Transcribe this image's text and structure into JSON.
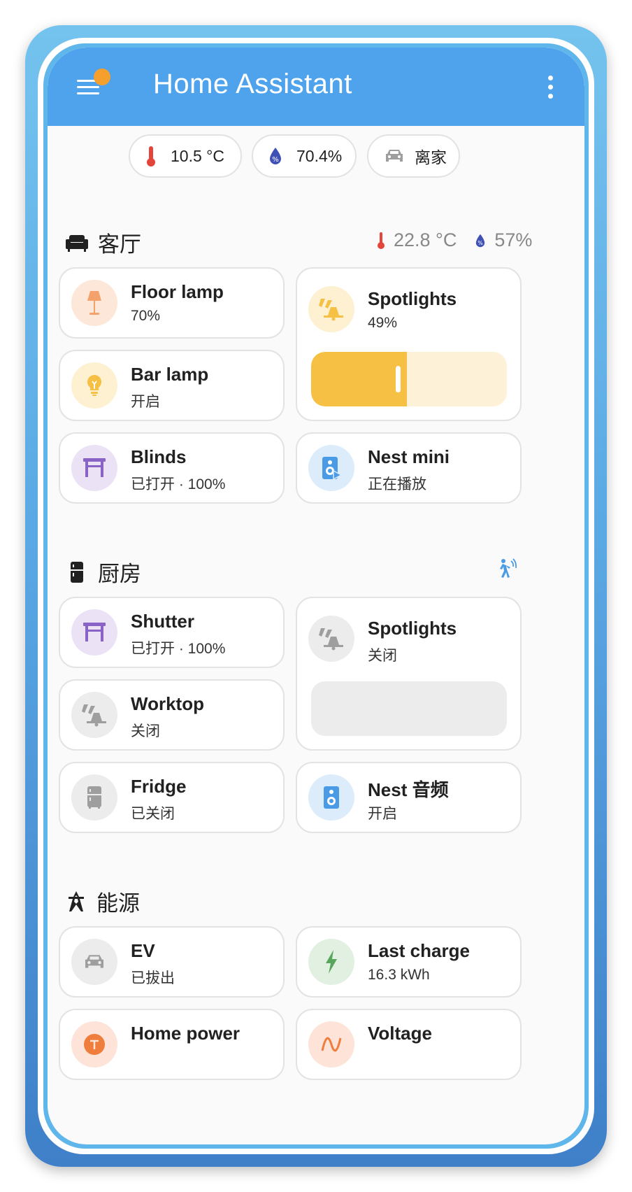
{
  "app": {
    "title": "Home Assistant"
  },
  "badges": [
    {
      "icon": "thermometer-icon",
      "text": "10.5 °C"
    },
    {
      "icon": "humidity-icon",
      "text": "70.4%"
    },
    {
      "icon": "car-icon",
      "text": "离家"
    }
  ],
  "sections": {
    "living": {
      "title": "客厅",
      "temperature": "22.8 °C",
      "humidity": "57%",
      "cards": {
        "floor_lamp": {
          "name": "Floor lamp",
          "state": "70%"
        },
        "spotlights": {
          "name": "Spotlights",
          "state": "49%",
          "brightness": 49
        },
        "bar_lamp": {
          "name": "Bar lamp",
          "state": "开启"
        },
        "blinds": {
          "name": "Blinds",
          "state": "已打开 · 100%"
        },
        "nest_mini": {
          "name": "Nest mini",
          "state": "正在播放"
        }
      }
    },
    "kitchen": {
      "title": "厨房",
      "cards": {
        "shutter": {
          "name": "Shutter",
          "state": "已打开 · 100%"
        },
        "spotlights": {
          "name": "Spotlights",
          "state": "关闭",
          "brightness": 0
        },
        "worktop": {
          "name": "Worktop",
          "state": "关闭"
        },
        "fridge": {
          "name": "Fridge",
          "state": "已关闭"
        },
        "nest_audio": {
          "name": "Nest 音频",
          "state": "开启"
        }
      }
    },
    "energy": {
      "title": "能源",
      "cards": {
        "ev": {
          "name": "EV",
          "state": "已拔出"
        },
        "last_charge": {
          "name": "Last charge",
          "state": "16.3 kWh"
        },
        "home_power": {
          "name": "Home power"
        },
        "voltage": {
          "name": "Voltage"
        }
      }
    }
  },
  "colors": {
    "header": "#4fa3ec",
    "light_on": "#f5c044",
    "cover": "#8a63c7",
    "media": "#4a9be6",
    "off": "#9e9e9e",
    "energy_green": "#58a65c",
    "power_orange": "#ef7d3c"
  }
}
